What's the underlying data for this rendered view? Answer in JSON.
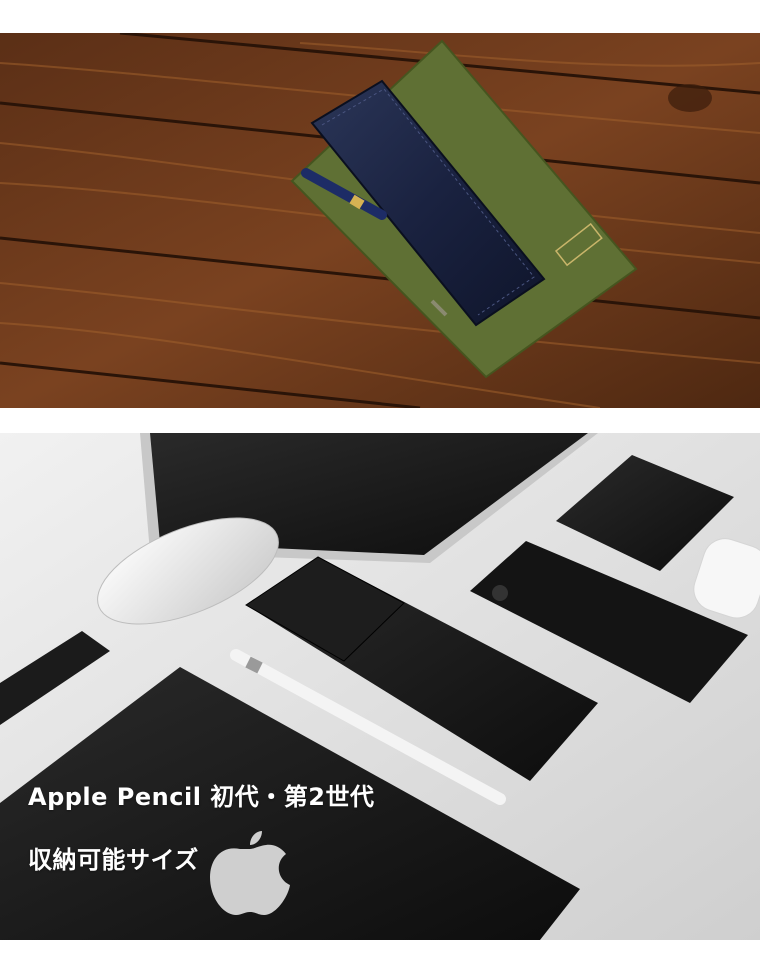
{
  "caption": {
    "line1": "Apple Pencil 初代・第2世代",
    "line2": "収納可能サイズ"
  },
  "colors": {
    "wood": "#6b3a1c",
    "notebook_green": "#5f7034",
    "navy_leather": "#1e2740",
    "black_leather": "#151515",
    "background_gray": "#dcdcdc"
  }
}
